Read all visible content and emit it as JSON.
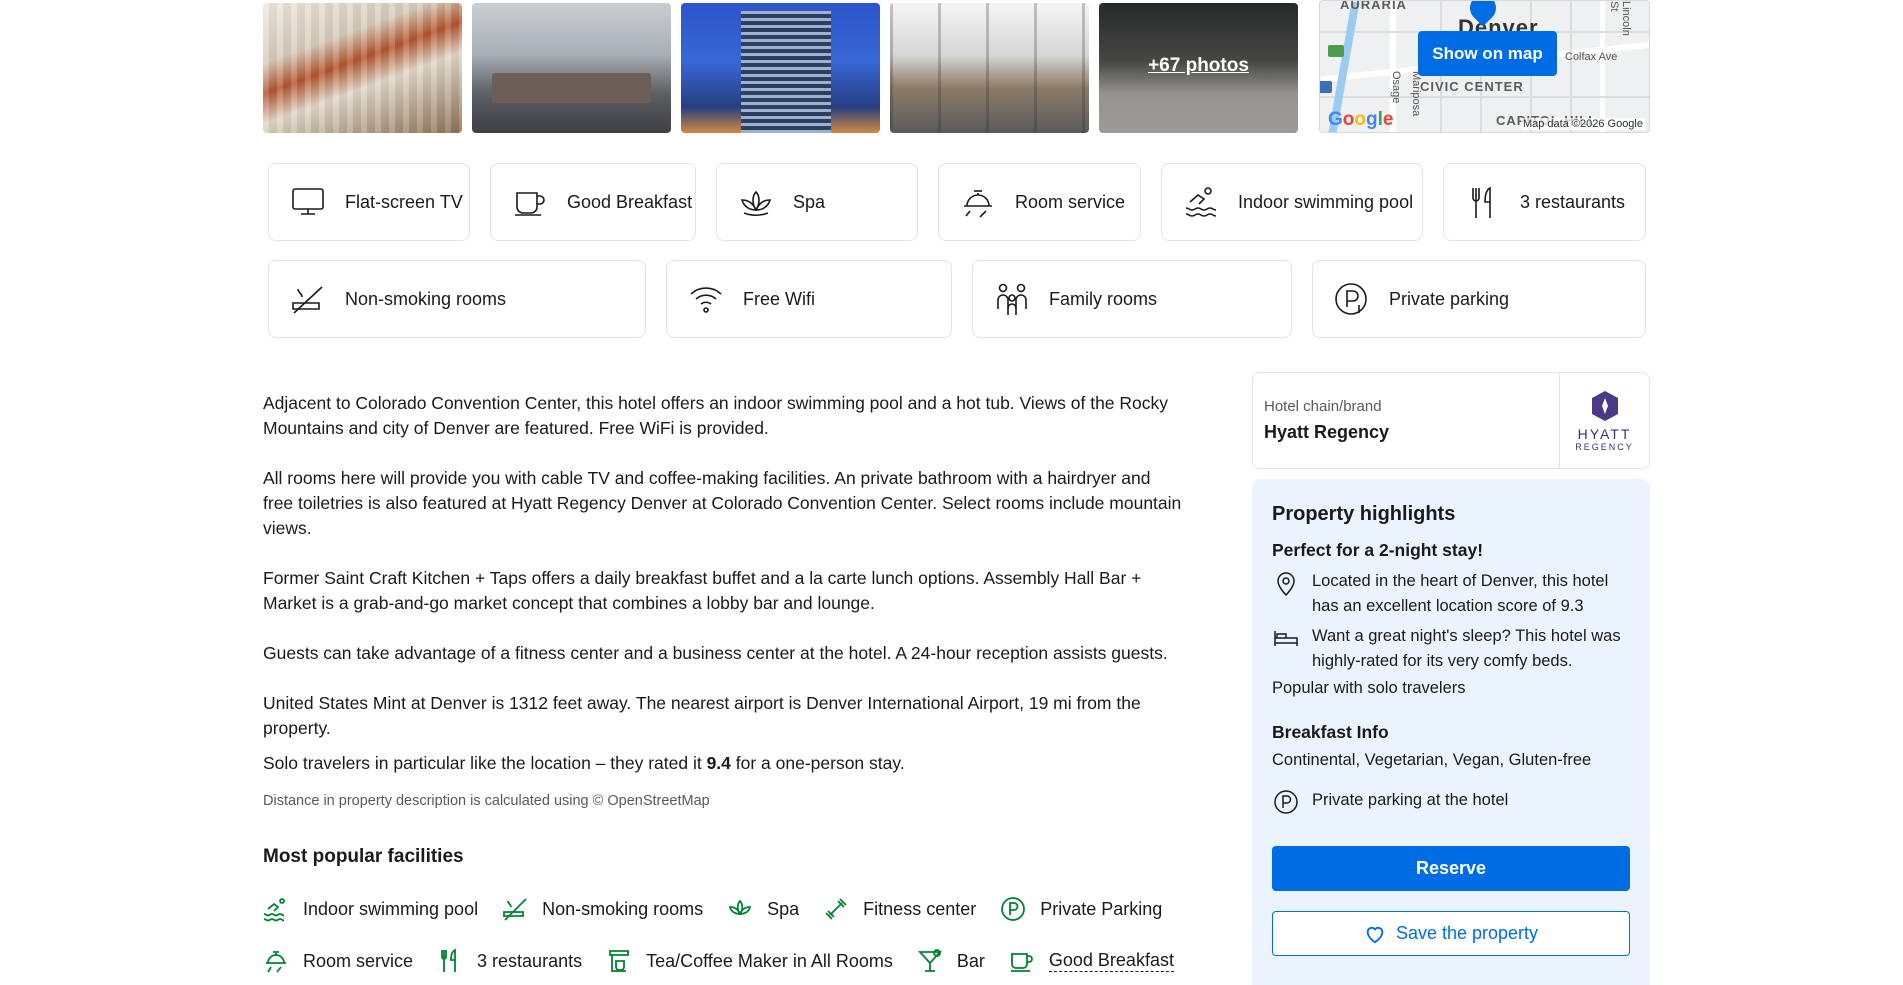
{
  "photos": {
    "more_label": "+67 photos"
  },
  "map": {
    "show_button": "Show on map",
    "labels": [
      "AURARIA",
      "CIVIC CENTER",
      "CAPITOL HILL",
      "Denver"
    ],
    "streets": [
      "Colfax Ave",
      "Osage",
      "Mariposa",
      "Lincoln St"
    ],
    "attribution": "Map data ©2026 Google",
    "google": "Google"
  },
  "facility_chips_row1": [
    {
      "icon": "tv-icon",
      "label": "Flat-screen TV"
    },
    {
      "icon": "cup-icon",
      "label": "Good Breakfast"
    },
    {
      "icon": "spa-icon",
      "label": "Spa"
    },
    {
      "icon": "room-service-icon",
      "label": "Room service"
    },
    {
      "icon": "pool-icon",
      "label": "Indoor swimming pool"
    },
    {
      "icon": "restaurant-icon",
      "label": "3 restaurants"
    }
  ],
  "facility_chips_row2": [
    {
      "icon": "no-smoking-icon",
      "label": "Non-smoking rooms"
    },
    {
      "icon": "wifi-icon",
      "label": "Free Wifi"
    },
    {
      "icon": "family-icon",
      "label": "Family rooms"
    },
    {
      "icon": "parking-icon",
      "label": "Private parking"
    }
  ],
  "description": {
    "p1": "Adjacent to Colorado Convention Center, this hotel offers an indoor swimming pool and a hot tub. Views of the Rocky Mountains and city of Denver are featured. Free WiFi is provided.",
    "p2": "All rooms here will provide you with cable TV and coffee-making facilities. An private bathroom with a hairdryer and free toiletries is also featured at Hyatt Regency Denver at Colorado Convention Center. Select rooms include mountain views.",
    "p3": "Former Saint Craft Kitchen + Taps offers a daily breakfast buffet and a la carte lunch options. Assembly Hall Bar + Market is a grab-and-go market concept that combines a lobby bar and lounge.",
    "p4": "Guests can take advantage of a fitness center and a business center at the hotel. A 24-hour reception assists guests.",
    "p5": "United States Mint at Denver is 1312 feet away. The nearest airport is Denver International Airport, 19 mi from the property.",
    "solo_prefix": "Solo travelers in particular like the location – they rated it ",
    "solo_score": "9.4",
    "solo_suffix": " for a one-person stay.",
    "osm_note": "Distance in property description is calculated using © OpenStreetMap"
  },
  "popular_facilities": {
    "title": "Most popular facilities",
    "row1": [
      "Indoor swimming pool",
      "Non-smoking rooms",
      "Spa",
      "Fitness center",
      "Private Parking"
    ],
    "row2": [
      "Room service",
      "3 restaurants",
      "Tea/Coffee Maker in All Rooms",
      "Bar",
      "Good Breakfast"
    ]
  },
  "brand": {
    "caption": "Hotel chain/brand",
    "name": "Hyatt Regency",
    "logo_word1": "HYATT",
    "logo_word2": "REGENCY"
  },
  "highlights": {
    "title": "Property highlights",
    "stay_title": "Perfect for a 2-night stay!",
    "location_text": "Located in the heart of Denver, this hotel has an excellent location score of 9.3",
    "sleep_text": "Want a great night's sleep? This hotel was highly-rated for its very comfy beds.",
    "solo_text": "Popular with solo travelers",
    "breakfast_title": "Breakfast Info",
    "breakfast_text": "Continental, Vegetarian, Vegan, Gluten-free",
    "parking_text": "Private parking at the hotel",
    "reserve_label": "Reserve",
    "save_label": "Save the property"
  },
  "colors": {
    "primary_blue": "#006ce4",
    "highlight_bg": "#ebf3ff",
    "facility_green": "#008234"
  }
}
